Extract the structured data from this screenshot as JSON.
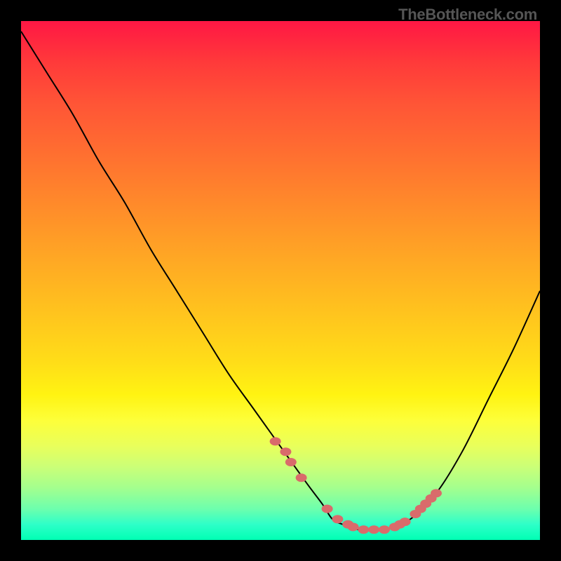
{
  "watermark": "TheBottleneck.com",
  "chart_data": {
    "type": "line",
    "title": "",
    "xlabel": "",
    "ylabel": "",
    "xlim": [
      0,
      100
    ],
    "ylim": [
      0,
      100
    ],
    "grid": false,
    "series": [
      {
        "name": "curve",
        "x": [
          0,
          5,
          10,
          15,
          20,
          25,
          30,
          35,
          40,
          45,
          50,
          55,
          58,
          60,
          62,
          65,
          70,
          75,
          80,
          85,
          90,
          95,
          100
        ],
        "y": [
          98,
          90,
          82,
          73,
          65,
          56,
          48,
          40,
          32,
          25,
          18,
          11,
          7,
          4,
          3,
          2,
          2,
          4,
          9,
          17,
          27,
          37,
          48
        ]
      }
    ],
    "scatter_points": {
      "name": "markers",
      "x": [
        49,
        51,
        52,
        54,
        59,
        61,
        63,
        64,
        66,
        68,
        70,
        72,
        73,
        74,
        76,
        77,
        78,
        79,
        80
      ],
      "y": [
        19,
        17,
        15,
        12,
        6,
        4,
        3,
        2.5,
        2,
        2,
        2,
        2.5,
        3,
        3.5,
        5,
        6,
        7,
        8,
        9
      ]
    },
    "gradient_colors": {
      "top": "#ff1744",
      "mid_upper": "#ff8c2a",
      "mid": "#ffde18",
      "mid_lower": "#caff78",
      "bottom": "#00ffb4"
    }
  }
}
